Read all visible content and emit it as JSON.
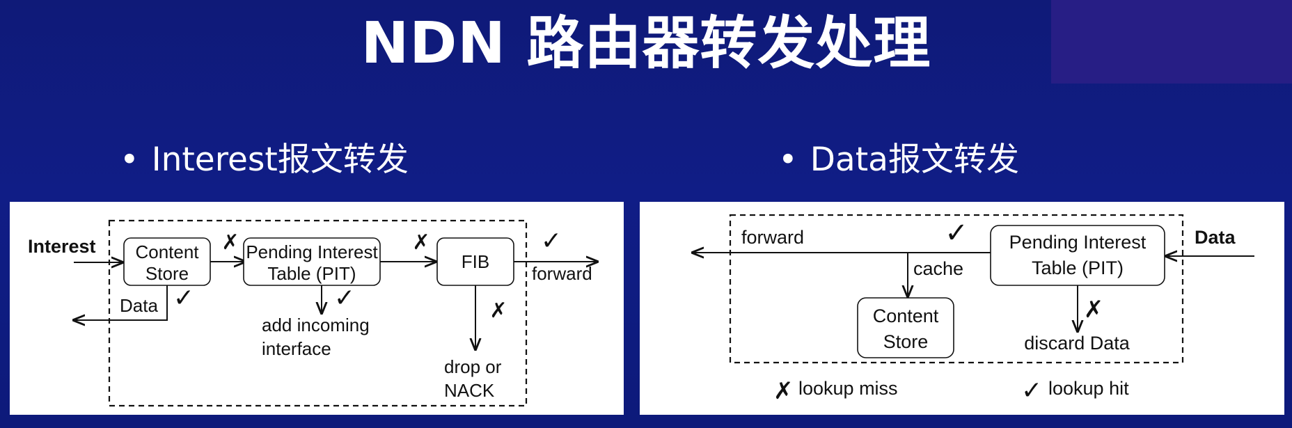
{
  "title": "NDN 路由器转发处理",
  "bullets": {
    "interest": "Interest报文转发",
    "data": "Data报文转发"
  },
  "bullet_symbol": "•",
  "interest_diagram": {
    "input_label": "Interest",
    "content_store": [
      "Content",
      "Store"
    ],
    "pit": [
      "Pending Interest",
      "Table (PIT)"
    ],
    "fib": "FIB",
    "forward_label": "forward",
    "data_label": "Data",
    "add_incoming": [
      "add incoming",
      "interface"
    ],
    "drop_nack": [
      "drop or",
      "NACK"
    ],
    "marks": {
      "cs_miss": "✗",
      "pit_miss": "✗",
      "fib_hit": "✓",
      "cs_hit": "✓",
      "pit_hit": "✓",
      "fib_miss": "✗"
    }
  },
  "data_diagram": {
    "input_label": "Data",
    "pit": [
      "Pending Interest",
      "Table (PIT)"
    ],
    "forward_label": "forward",
    "cache_label": "cache",
    "content_store": [
      "Content",
      "Store"
    ],
    "discard_label": "discard Data",
    "marks": {
      "pit_hit": "✓",
      "pit_miss": "✗"
    }
  },
  "legend": {
    "miss_symbol": "✗",
    "miss_label": "lookup miss",
    "hit_symbol": "✓",
    "hit_label": "lookup hit"
  },
  "colors": {
    "background": "#101d86",
    "text": "#ffffff",
    "panel": "#ffffff",
    "diagram_ink": "#111111"
  }
}
